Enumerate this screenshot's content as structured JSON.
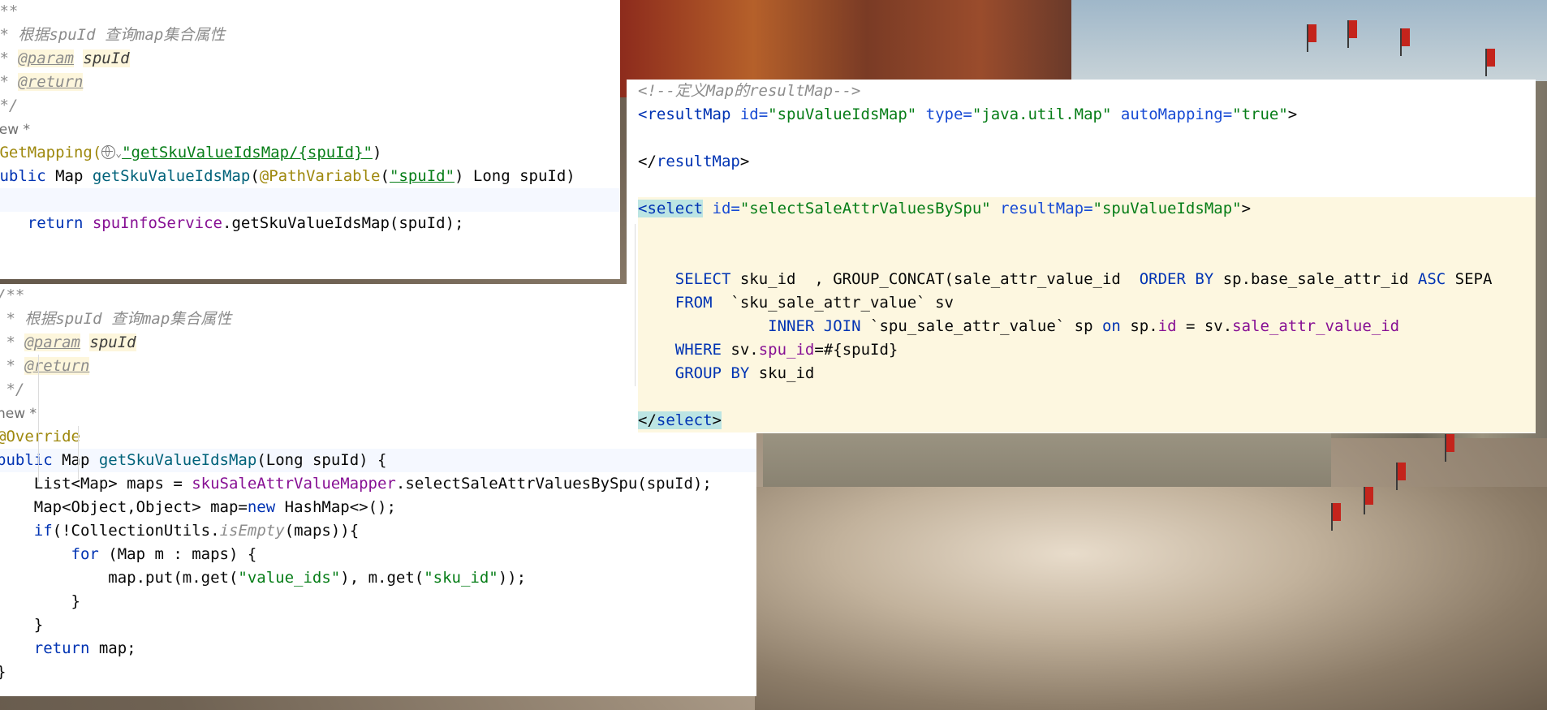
{
  "panel_top_left": {
    "lines": [
      [
        {
          "t": "/**",
          "c": "comment"
        }
      ],
      [
        {
          "t": " * 根据spuId 查询map集合属性",
          "c": "comment"
        }
      ],
      [
        {
          "t": " * ",
          "c": "comment"
        },
        {
          "t": "@param",
          "c": "doctag"
        },
        {
          "t": " ",
          "c": "comment"
        },
        {
          "t": "spuId",
          "c": "docval"
        }
      ],
      [
        {
          "t": " * ",
          "c": "comment"
        },
        {
          "t": "@return",
          "c": "doctag"
        }
      ],
      [
        {
          "t": " */",
          "c": "comment"
        }
      ],
      [
        {
          "t": "new *",
          "c": "hint"
        }
      ],
      [
        {
          "t": "@GetMapping(",
          "c": "ann"
        },
        {
          "t": "",
          "c": "globe"
        },
        {
          "t": "⌄",
          "c": "chev"
        },
        {
          "t": "\"getSkuValueIdsMap/{spuId}\"",
          "c": "str under"
        },
        {
          "t": ")",
          "c": ""
        }
      ],
      [
        {
          "t": "public ",
          "c": "kw"
        },
        {
          "t": "Map ",
          "c": ""
        },
        {
          "t": "getSkuValueIdsMap",
          "c": "fn"
        },
        {
          "t": "(",
          "c": ""
        },
        {
          "t": "@PathVariable",
          "c": "ann"
        },
        {
          "t": "(",
          "c": ""
        },
        {
          "t": "\"spuId\"",
          "c": "str under"
        },
        {
          "t": ") Long spuId)",
          "c": ""
        }
      ],
      [
        {
          "t": "",
          "c": ""
        }
      ],
      [
        {
          "t": "    return ",
          "c": "kw"
        },
        {
          "t": "spuInfoService",
          "c": "field"
        },
        {
          "t": ".getSkuValueIdsMap(spuId);",
          "c": ""
        }
      ],
      [
        {
          "t": "",
          "c": ""
        }
      ]
    ]
  },
  "panel_bottom_left": {
    "lines": [
      [
        {
          "t": "/**",
          "c": "comment"
        }
      ],
      [
        {
          "t": " * 根据spuId 查询map集合属性",
          "c": "comment"
        }
      ],
      [
        {
          "t": " * ",
          "c": "comment"
        },
        {
          "t": "@param",
          "c": "doctag"
        },
        {
          "t": " ",
          "c": "comment"
        },
        {
          "t": "spuId",
          "c": "docval"
        }
      ],
      [
        {
          "t": " * ",
          "c": "comment"
        },
        {
          "t": "@return",
          "c": "doctag"
        }
      ],
      [
        {
          "t": " */",
          "c": "comment"
        }
      ],
      [
        {
          "t": "new *",
          "c": "hint"
        }
      ],
      [
        {
          "t": "@Override",
          "c": "ann"
        }
      ],
      [
        {
          "t": "public ",
          "c": "kw"
        },
        {
          "t": "Map ",
          "c": ""
        },
        {
          "t": "getSkuValueIdsMap",
          "c": "fn"
        },
        {
          "t": "(Long spuId) {",
          "c": ""
        }
      ],
      [
        {
          "t": "    List<Map> maps = ",
          "c": ""
        },
        {
          "t": "skuSaleAttrValueMapper",
          "c": "field"
        },
        {
          "t": ".selectSaleAttrValuesBySpu(spuId);",
          "c": ""
        }
      ],
      [
        {
          "t": "    Map<Object,Object> map=",
          "c": ""
        },
        {
          "t": "new ",
          "c": "kw"
        },
        {
          "t": "HashMap<>();",
          "c": ""
        }
      ],
      [
        {
          "t": "    ",
          "c": ""
        },
        {
          "t": "if",
          "c": "kw"
        },
        {
          "t": "(!CollectionUtils.",
          "c": ""
        },
        {
          "t": "isEmpty",
          "c": "comment"
        },
        {
          "t": "(maps)){",
          "c": ""
        }
      ],
      [
        {
          "t": "        ",
          "c": ""
        },
        {
          "t": "for ",
          "c": "kw"
        },
        {
          "t": "(Map m : maps) {",
          "c": ""
        }
      ],
      [
        {
          "t": "            map.put(m.get(",
          "c": ""
        },
        {
          "t": "\"value_ids\"",
          "c": "str"
        },
        {
          "t": "), m.get(",
          "c": ""
        },
        {
          "t": "\"sku_id\"",
          "c": "str"
        },
        {
          "t": "));",
          "c": ""
        }
      ],
      [
        {
          "t": "        }",
          "c": ""
        }
      ],
      [
        {
          "t": "    }",
          "c": ""
        }
      ],
      [
        {
          "t": "    ",
          "c": ""
        },
        {
          "t": "return ",
          "c": "kw"
        },
        {
          "t": "map;",
          "c": ""
        }
      ],
      [
        {
          "t": "}",
          "c": ""
        }
      ]
    ]
  },
  "panel_right": {
    "lines": [
      [
        {
          "t": "<!--定义Map的resultMap-->",
          "c": "comment"
        }
      ],
      [
        {
          "t": "<resultMap ",
          "c": "tag"
        },
        {
          "t": "id=",
          "c": "attr"
        },
        {
          "t": "\"spuValueIdsMap\" ",
          "c": "str"
        },
        {
          "t": "type=",
          "c": "attr"
        },
        {
          "t": "\"java.util.Map\" ",
          "c": "str"
        },
        {
          "t": "autoMapping=",
          "c": "attr"
        },
        {
          "t": "\"true\"",
          "c": "str"
        },
        {
          "t": ">",
          "c": ""
        }
      ],
      [
        {
          "t": "",
          "c": ""
        }
      ],
      [
        {
          "t": "</",
          "c": ""
        },
        {
          "t": "resultMap",
          "c": "tag"
        },
        {
          "t": ">",
          "c": ""
        }
      ],
      [
        {
          "t": "",
          "c": ""
        }
      ],
      [
        {
          "t": "<select",
          "c": "tag hl-tag"
        },
        {
          "t": " ",
          "c": ""
        },
        {
          "t": "id=",
          "c": "attr"
        },
        {
          "t": "\"selectSaleAttrValuesBySpu\" ",
          "c": "str"
        },
        {
          "t": "resultMap=",
          "c": "attr"
        },
        {
          "t": "\"spuValueIdsMap\"",
          "c": "str"
        },
        {
          "t": ">",
          "c": ""
        }
      ],
      [
        {
          "t": "",
          "c": ""
        }
      ],
      [
        {
          "t": "",
          "c": ""
        }
      ],
      [
        {
          "t": "    ",
          "c": ""
        },
        {
          "t": "SELECT ",
          "c": "kw"
        },
        {
          "t": "sku_id  , GROUP_CONCAT(sale_attr_value_id  ",
          "c": ""
        },
        {
          "t": "ORDER BY ",
          "c": "kw"
        },
        {
          "t": "sp.base_sale_attr_id ",
          "c": ""
        },
        {
          "t": "ASC ",
          "c": "kw"
        },
        {
          "t": "SEPA",
          "c": ""
        }
      ],
      [
        {
          "t": "    ",
          "c": ""
        },
        {
          "t": "FROM  ",
          "c": "kw"
        },
        {
          "t": "`sku_sale_attr_value` sv",
          "c": ""
        }
      ],
      [
        {
          "t": "              ",
          "c": ""
        },
        {
          "t": "INNER JOIN ",
          "c": "kw"
        },
        {
          "t": "`spu_sale_attr_value` sp ",
          "c": ""
        },
        {
          "t": "on ",
          "c": "kw"
        },
        {
          "t": "sp.",
          "c": ""
        },
        {
          "t": "id ",
          "c": "field"
        },
        {
          "t": "= sv.",
          "c": ""
        },
        {
          "t": "sale_attr_value_id",
          "c": "field"
        }
      ],
      [
        {
          "t": "    ",
          "c": ""
        },
        {
          "t": "WHERE ",
          "c": "kw"
        },
        {
          "t": "sv.",
          "c": ""
        },
        {
          "t": "spu_id",
          "c": "field"
        },
        {
          "t": "=#{spuId}",
          "c": ""
        }
      ],
      [
        {
          "t": "    ",
          "c": ""
        },
        {
          "t": "GROUP BY ",
          "c": "kw"
        },
        {
          "t": "sku_id",
          "c": ""
        }
      ],
      [
        {
          "t": "",
          "c": ""
        }
      ],
      [
        {
          "t": "</",
          "c": "hl-tag"
        },
        {
          "t": "select",
          "c": "tag hl-tag"
        },
        {
          "t": ">",
          "c": "hl-tag"
        }
      ]
    ]
  },
  "colors": {
    "keyword": "#0033b3",
    "string": "#067d17",
    "annotation": "#9e880d",
    "comment": "#8c8c8c",
    "field": "#871094",
    "method": "#00627a",
    "select_block_bg": "#fdf7e0"
  },
  "icons": [
    "globe-icon",
    "chevron-down-icon"
  ]
}
